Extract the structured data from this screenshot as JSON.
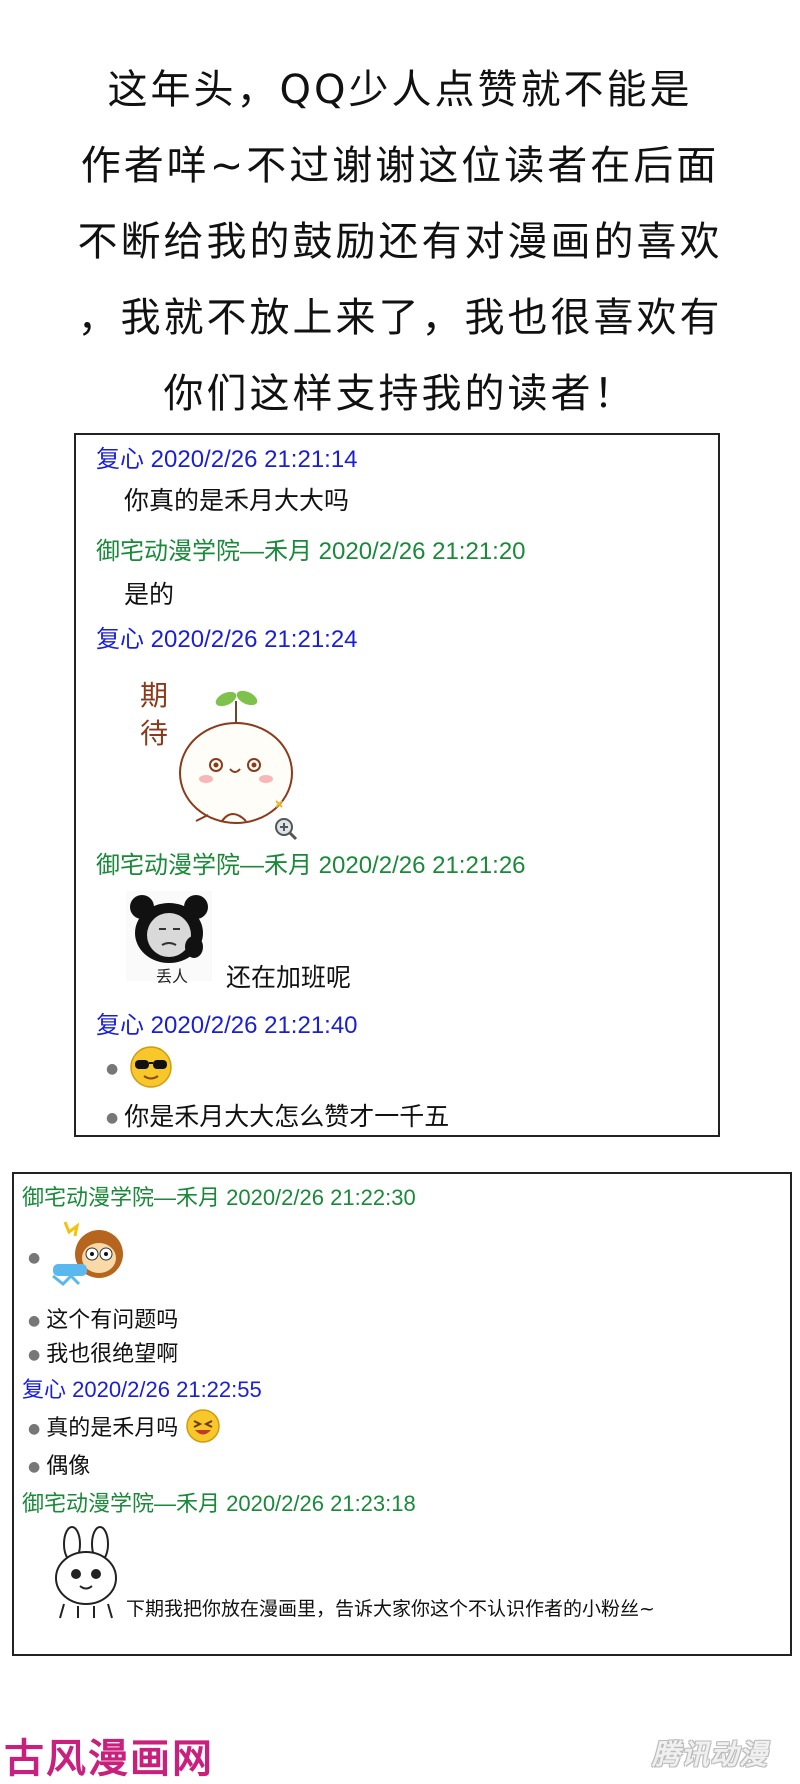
{
  "intro": {
    "lines": [
      "这年头，QQ少人点赞就不能是",
      "作者咩~不过谢谢这位读者在后面",
      "不断给我的鼓励还有对漫画的喜欢",
      "，我就不放上来了，我也很喜欢有",
      "你们这样支持我的读者！"
    ]
  },
  "chat1": {
    "m1_header": "复心 2020/2/26 21:21:14",
    "m1_text": "你真的是禾月大大吗",
    "m2_header": "御宅动漫学院—禾月 2020/2/26 21:21:20",
    "m2_text": "是的",
    "m3_header": "复心 2020/2/26 21:21:24",
    "m3_sticker_text": "期待",
    "m4_header": "御宅动漫学院—禾月 2020/2/26 21:21:26",
    "m4_sticker_caption": "丢人",
    "m4_text": "还在加班呢",
    "m5_header": "复心 2020/2/26 21:21:40",
    "m5_text": "你是禾月大大怎么赞才一千五"
  },
  "chat2": {
    "m1_header": "御宅动漫学院—禾月 2020/2/26 21:22:30",
    "m1_line1": "这个有问题吗",
    "m1_line2": "我也很绝望啊",
    "m2_header": "复心 2020/2/26 21:22:55",
    "m2_line1": "真的是禾月吗",
    "m2_line2": "偶像",
    "m3_header": "御宅动漫学院—禾月 2020/2/26 21:23:18",
    "m3_text": "下期我把你放在漫画里，告诉大家你这个不认识作者的小粉丝~"
  },
  "footer": {
    "left_logo": "古风漫画网",
    "right_logo": "腾讯动漫"
  },
  "colors": {
    "blue_name": "#1a1fd6",
    "green_name": "#1a8a3a",
    "logo_pink": "#c8207c"
  },
  "icons": [
    "sprout-bun-sticker",
    "panda-meme-sticker",
    "sunglasses-emoji",
    "monkey-sticker",
    "laughing-emoji",
    "bunny-sticker",
    "zoom-icon"
  ]
}
